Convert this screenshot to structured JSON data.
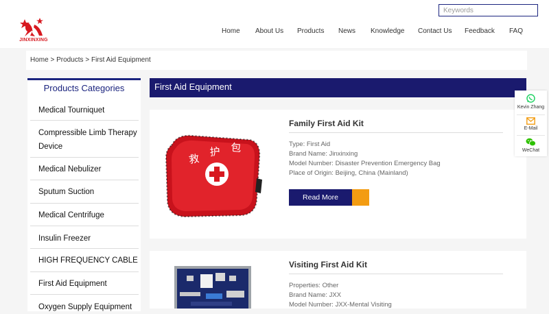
{
  "brand": {
    "logo_text": "JINXINXING",
    "logo_color": "#d71920"
  },
  "search": {
    "placeholder": "Keywords"
  },
  "nav": [
    "Home",
    "About Us",
    "Products",
    "News",
    "Knowledge",
    "Contact Us",
    "Feedback",
    "FAQ"
  ],
  "breadcrumb": {
    "home": "Home",
    "sep1": " > ",
    "products": "Products",
    "sep2": " > ",
    "current": "First Aid Equipment"
  },
  "sidebar": {
    "title": "Products Categories",
    "items": [
      "Medical Tourniquet",
      "Compressible Limb Therapy Device",
      "Medical Nebulizer",
      "Sputum Suction",
      "Medical Centrifuge",
      "Insulin Freezer",
      "HIGH FREQUENCY CABLE",
      "First Aid Equipment",
      "Oxygen Supply Equipment"
    ]
  },
  "main": {
    "title": "First Aid Equipment",
    "products": [
      {
        "name": "Family First Aid Kit",
        "specs": [
          "Type: First Aid",
          "Brand Name: Jinxinxing",
          "Model Number: Disaster Prevention Emergency Bag",
          "Place of Origin: Beijing, China (Mainland)"
        ],
        "bag_text": "救护包",
        "button": "Read More"
      },
      {
        "name": "Visiting First Aid Kit",
        "specs": [
          "Properties: Other",
          "Brand Name: JXX",
          "Model Number: JXX-Mental Visiting"
        ]
      }
    ]
  },
  "contact": [
    {
      "label": "Kevin Zhang",
      "icon": "whatsapp-icon"
    },
    {
      "label": "E-Mail",
      "icon": "mail-icon"
    },
    {
      "label": "WeChat",
      "icon": "wechat-icon"
    }
  ],
  "colors": {
    "navy": "#1a1a6e",
    "orange": "#f39c12",
    "red": "#d71920",
    "whatsapp": "#25d366",
    "mail": "#f39c12",
    "wechat": "#2dc100"
  }
}
